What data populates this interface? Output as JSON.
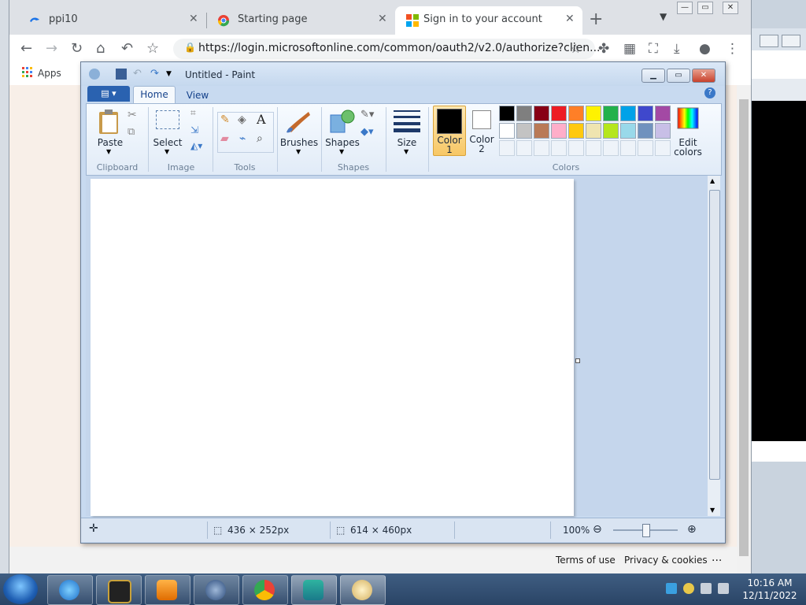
{
  "browser": {
    "tabs": [
      {
        "title": "ppi10",
        "favicon": "edge-ocean-icon"
      },
      {
        "title": "Starting page",
        "favicon": "chrome-startpage-icon"
      },
      {
        "title": "Sign in to your account",
        "favicon": "microsoft-logo-icon"
      }
    ],
    "url": "https://login.microsoftonline.com/common/oauth2/v2.0/authorize?clien...",
    "bookmarks": {
      "apps_label": "Apps"
    },
    "footer": {
      "terms": "Terms of use",
      "privacy": "Privacy & cookies",
      "more": "..."
    }
  },
  "paint": {
    "title": "Untitled - Paint",
    "ribbon_tabs": [
      "Home",
      "View"
    ],
    "groups": {
      "clipboard": {
        "label": "Clipboard",
        "paste": "Paste"
      },
      "image": {
        "label": "Image",
        "select": "Select"
      },
      "tools": {
        "label": "Tools"
      },
      "brushes": {
        "label": "Brushes"
      },
      "shapes": {
        "label": "Shapes",
        "shapes_btn": "Shapes"
      },
      "size": {
        "label": "Size"
      },
      "colors": {
        "label": "Colors",
        "color1_a": "Color",
        "color1_b": "1",
        "color2_a": "Color",
        "color2_b": "2",
        "edit_a": "Edit",
        "edit_b": "colors"
      }
    },
    "palette_row1": [
      "#000000",
      "#7f7f7f",
      "#880015",
      "#ed1c24",
      "#ff7f27",
      "#fff200",
      "#22b14c",
      "#00a2e8",
      "#3f48cc",
      "#a349a4"
    ],
    "palette_row2": [
      "#ffffff",
      "#c3c3c3",
      "#b97a57",
      "#ffaec9",
      "#ffc90e",
      "#efe4b0",
      "#b5e61d",
      "#99d9ea",
      "#7092be",
      "#c8bfe7"
    ],
    "color1": "#000000",
    "color2": "#ffffff",
    "status": {
      "selection_size": "436 × 252px",
      "canvas_size": "614 × 460px",
      "zoom": "100%"
    }
  },
  "taskbar": {
    "apps": [
      "ie-icon",
      "terminal-icon",
      "media-player-icon",
      "steam-like-icon",
      "chrome-icon",
      "remote-app-icon",
      "paint-icon"
    ],
    "time": "10:16 AM",
    "date": "12/11/2022"
  }
}
